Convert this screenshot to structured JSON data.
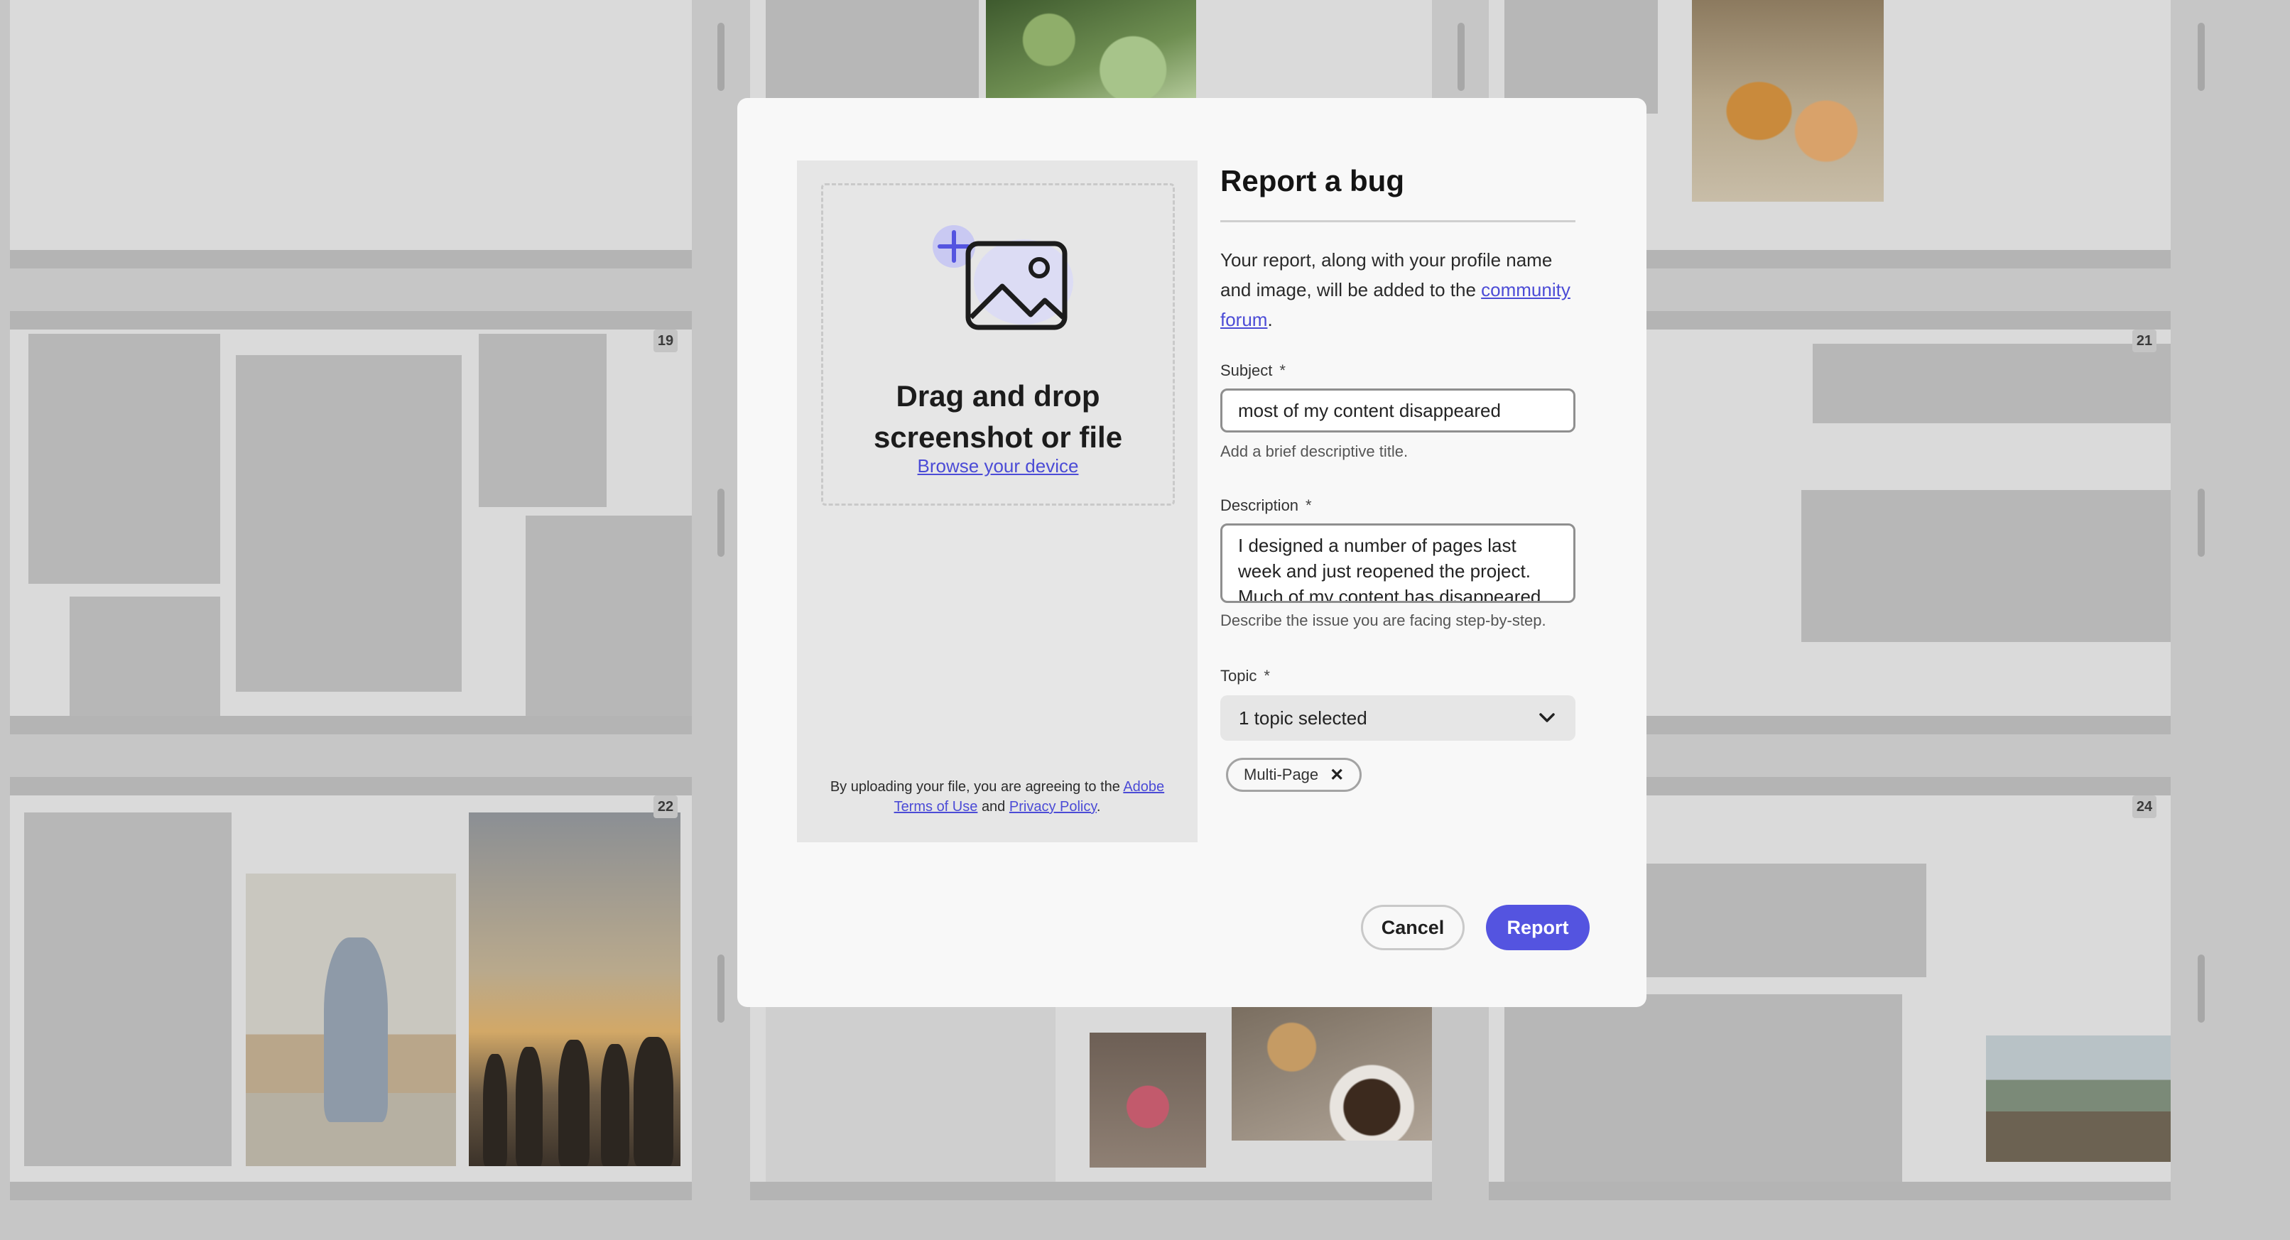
{
  "background_pages": {
    "page_numbers": [
      "19",
      "21",
      "22",
      "24"
    ]
  },
  "upload": {
    "title": "Drag and drop screenshot or file",
    "browse_label": "Browse your device",
    "legal_prefix": "By uploading your file, you are agreeing to the",
    "terms_label": "Adobe Terms of Use",
    "legal_and": "and",
    "privacy_label": "Privacy Policy",
    "legal_suffix": "."
  },
  "form": {
    "title": "Report a bug",
    "intro_text": "Your report, along with your profile name and image, will be added to the",
    "intro_link": "community forum",
    "intro_suffix": ".",
    "subject": {
      "label": "Subject",
      "required_mark": "*",
      "value": "most of my content disappeared",
      "help": "Add a brief descriptive title."
    },
    "description": {
      "label": "Description",
      "required_mark": "*",
      "value": "I designed a number of pages last week and just reopened the project. Much of my content has disappeared.",
      "help": "Describe the issue you are facing step-by-step."
    },
    "topic": {
      "label": "Topic",
      "required_mark": "*",
      "selected_text": "1 topic selected",
      "chips": [
        "Multi-Page"
      ]
    }
  },
  "actions": {
    "cancel_label": "Cancel",
    "report_label": "Report"
  },
  "colors": {
    "accent": "#5454e0",
    "link": "#4b4bd6",
    "overlay": "#c6c6c6"
  }
}
